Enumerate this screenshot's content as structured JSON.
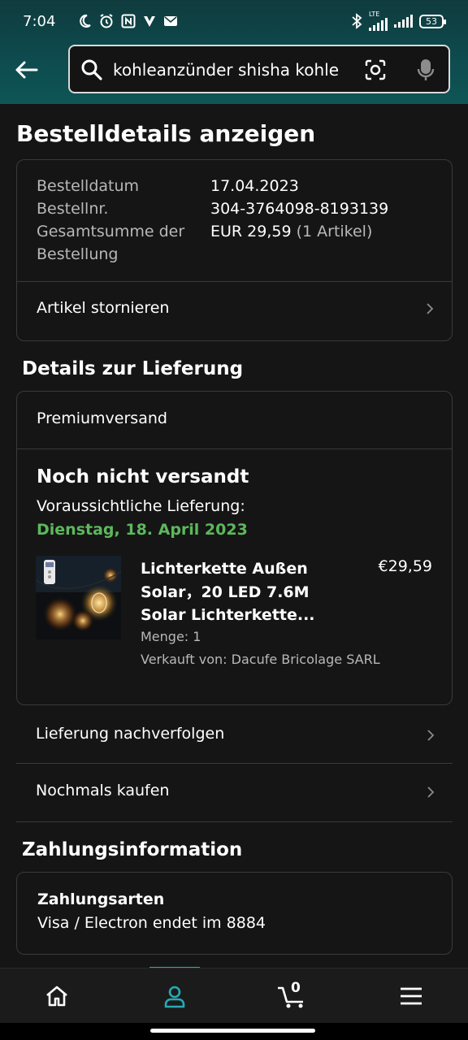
{
  "status_bar": {
    "time": "7:04",
    "battery": "53",
    "network": "LTE"
  },
  "search": {
    "query": "kohleanzünder shisha kohle"
  },
  "page": {
    "title": "Bestelldetails anzeigen"
  },
  "order_summary": {
    "rows": [
      {
        "label": "Bestelldatum",
        "value": "17.04.2023"
      },
      {
        "label": "Bestellnr.",
        "value": "304-3764098-8193139"
      },
      {
        "label": "Gesamtsumme der Bestellung",
        "value": "EUR 29,59",
        "value_extra": "(1 Artikel)"
      }
    ],
    "cancel_label": "Artikel stornieren"
  },
  "delivery": {
    "heading": "Details zur Lieferung",
    "shipping_type": "Premiumversand",
    "status": "Noch nicht versandt",
    "eta_label": "Voraussichtliche Lieferung:",
    "eta_date": "Dienstag, 18. April 2023",
    "item": {
      "title": "Lichterkette Außen Solar，20 LED 7.6M Solar Lichterkette...",
      "price": "€29,59",
      "quantity": "Menge: 1",
      "seller": "Verkauft von: Dacufe Bricolage SARL"
    },
    "track_label": "Lieferung nachverfolgen",
    "buy_again_label": "Nochmals kaufen"
  },
  "payment": {
    "heading": "Zahlungsinformation",
    "methods_heading": "Zahlungsarten",
    "method": "Visa / Electron  endet im 8884"
  },
  "bottom_nav": {
    "cart_count": "0",
    "items": [
      "home-icon",
      "account-icon",
      "cart-icon",
      "menu-icon"
    ],
    "active_color": "#27aab4"
  },
  "colors": {
    "accent_green": "#5cb85c",
    "background": "#151515",
    "header": "#0e4c4f"
  }
}
